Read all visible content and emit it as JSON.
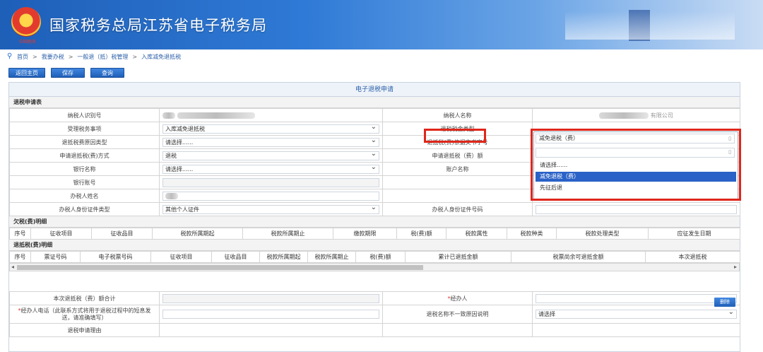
{
  "header": {
    "title": "国家税务总局江苏省电子税务局",
    "emblem_caption": "中国税务"
  },
  "breadcrumb": [
    "首页",
    "我要办税",
    "一般退（抵）税管理",
    "入库减免退抵税"
  ],
  "toolbar": {
    "back_label": "返回主页",
    "save_label": "保存",
    "query_label": "查询"
  },
  "form": {
    "caption": "电子退税申请",
    "section_apply": "退税申请表",
    "rows": {
      "taxpayer_id_label": "纳税人识别号",
      "taxpayer_name_label": "纳税人名称",
      "taxpayer_name_suffix": "有限公司",
      "matter_label": "受理税务事项",
      "matter_value": "入库减免退抵税",
      "refund_type_label": "退税税金类型",
      "reason_label": "退抵税费原因类型",
      "reason_value": "请选择......",
      "doc_label": "退抵税(费)依据文书字号",
      "method_label": "申请退抵税(费)方式",
      "method_value": "退税",
      "amount_label": "申请退抵税（费）额",
      "bank_label": "银行名称",
      "bank_value": "请选择......",
      "account_name_label": "账户名称",
      "account_no_label": "银行账号",
      "agent_name_label": "办税人姓名",
      "agent_id_type_label": "办税人身份证件类型",
      "agent_id_type_value": "其他个人证件",
      "agent_id_no_label": "办税人身份证件号码"
    },
    "section_owed": "欠税(费)明细",
    "owed_headers": [
      "序号",
      "征收项目",
      "征收品目",
      "税款所属期起",
      "税款所属期止",
      "缴款期限",
      "税(费)额",
      "税款属性",
      "税款种类",
      "税款处理类型",
      "应征发生日期"
    ],
    "section_refund": "退抵税(费)明细",
    "refund_headers": [
      "序号",
      "票证号码",
      "电子税票号码",
      "征收项目",
      "征收品目",
      "税款所属期起",
      "税款所属期止",
      "税(费)额",
      "累计已退抵金额",
      "税票尚余可退抵金额",
      "本次退抵税"
    ],
    "delete_label": "删除",
    "total_label": "本次退抵税（费）额合计",
    "handler_label": "经办人",
    "phone_label": "经办人电话（此联系方式将用于退税过程中的短息发送，请准确填写）",
    "mismatch_label": "退税名称不一致原因说明",
    "mismatch_value": "请选择",
    "partial_label": "退税申请理由"
  },
  "dropdown": {
    "selected": "减免退税（费）",
    "options": [
      "请选择......",
      "减免退税（费）",
      "先征后退"
    ],
    "active_index": 1
  }
}
